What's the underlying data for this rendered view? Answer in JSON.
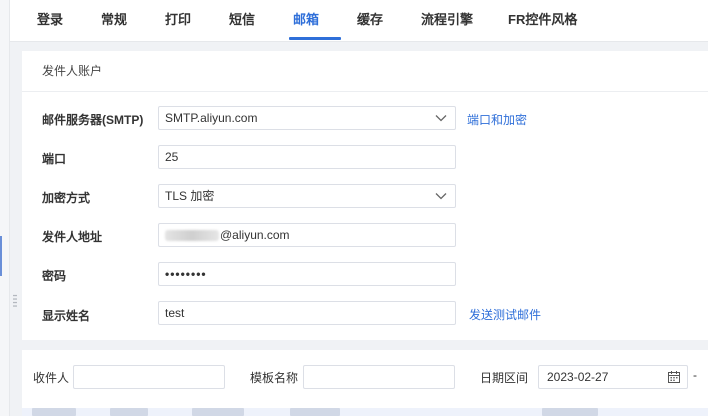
{
  "tabs": [
    {
      "label": "登录",
      "active": false
    },
    {
      "label": "常规",
      "active": false
    },
    {
      "label": "打印",
      "active": false
    },
    {
      "label": "短信",
      "active": false
    },
    {
      "label": "邮箱",
      "active": true
    },
    {
      "label": "缓存",
      "active": false
    },
    {
      "label": "流程引擎",
      "active": false
    },
    {
      "label": "FR控件风格",
      "active": false
    }
  ],
  "sender_account": {
    "title": "发件人账户",
    "smtp_label": "邮件服务器(SMTP)",
    "smtp_value": "SMTP.aliyun.com",
    "port_encrypt_link": "端口和加密",
    "port_label": "端口",
    "port_value": "25",
    "encryption_label": "加密方式",
    "encryption_value": "TLS 加密",
    "sender_address_label": "发件人地址",
    "sender_address_value": "@aliyun.com",
    "password_label": "密码",
    "password_value": "••••••••",
    "display_name_label": "显示姓名",
    "display_name_value": "test",
    "send_test_link": "发送测试邮件"
  },
  "filters": {
    "recipient_label": "收件人",
    "recipient_value": "",
    "template_label": "模板名称",
    "template_value": "",
    "date_range_label": "日期区间",
    "date_start": "2023-02-27",
    "date_sep": "-"
  },
  "colors": {
    "accent": "#2f6fd9",
    "border": "#dcdfe6",
    "background": "#f0f2f5"
  }
}
